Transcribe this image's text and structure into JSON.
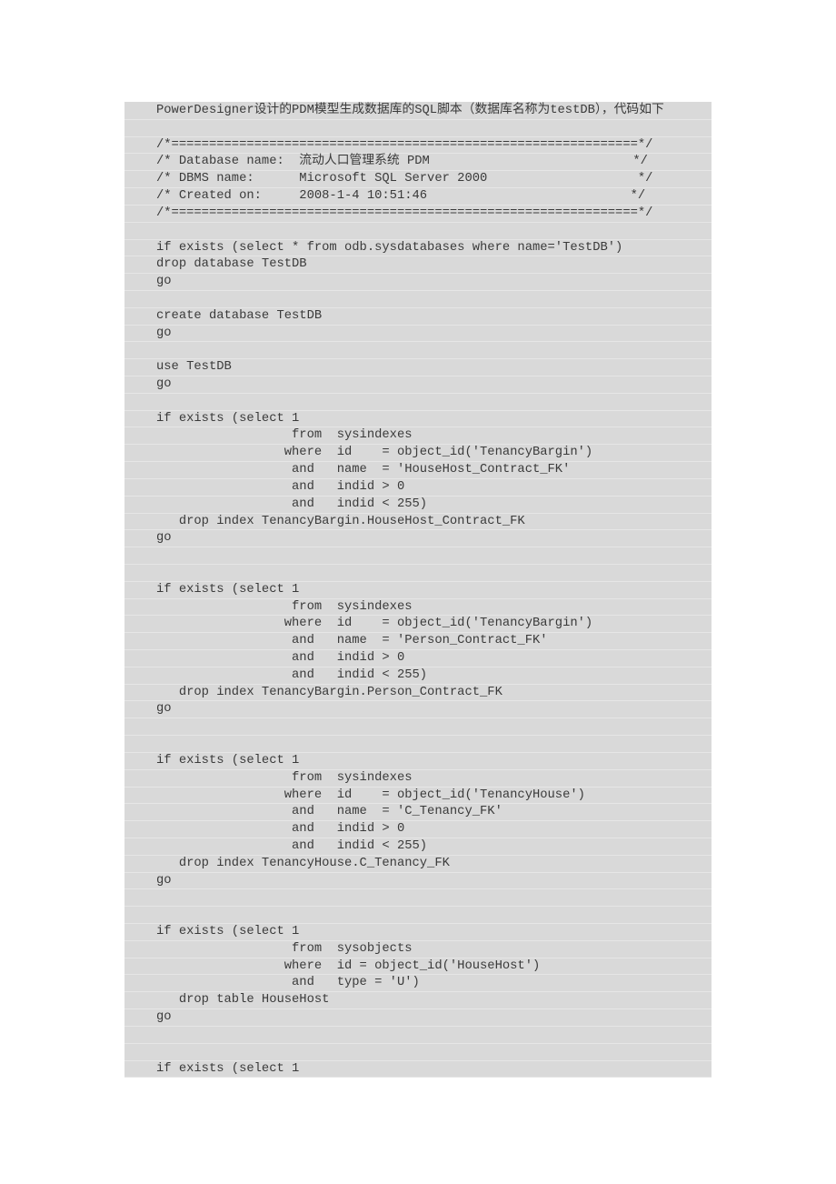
{
  "document": {
    "lines": [
      "PowerDesigner设计的PDM模型生成数据库的SQL脚本（数据库名称为testDB），代码如下",
      "",
      "/*==============================================================*/",
      "/* Database name:  流动人口管理系统 PDM                           */",
      "/* DBMS name:      Microsoft SQL Server 2000                    */",
      "/* Created on:     2008-1-4 10:51:46                           */",
      "/*==============================================================*/",
      "",
      "if exists (select * from odb.sysdatabases where name='TestDB')",
      "drop database TestDB",
      "go",
      "",
      "create database TestDB",
      "go",
      "",
      "use TestDB",
      "go",
      "",
      "if exists (select 1",
      "                  from  sysindexes",
      "                 where  id    = object_id('TenancyBargin')",
      "                  and   name  = 'HouseHost_Contract_FK'",
      "                  and   indid > 0",
      "                  and   indid < 255)",
      "   drop index TenancyBargin.HouseHost_Contract_FK",
      "go",
      "",
      "",
      "if exists (select 1",
      "                  from  sysindexes",
      "                 where  id    = object_id('TenancyBargin')",
      "                  and   name  = 'Person_Contract_FK'",
      "                  and   indid > 0",
      "                  and   indid < 255)",
      "   drop index TenancyBargin.Person_Contract_FK",
      "go",
      "",
      "",
      "if exists (select 1",
      "                  from  sysindexes",
      "                 where  id    = object_id('TenancyHouse')",
      "                  and   name  = 'C_Tenancy_FK'",
      "                  and   indid > 0",
      "                  and   indid < 255)",
      "   drop index TenancyHouse.C_Tenancy_FK",
      "go",
      "",
      "",
      "if exists (select 1",
      "                  from  sysobjects",
      "                 where  id = object_id('HouseHost')",
      "                  and   type = 'U')",
      "   drop table HouseHost",
      "go",
      "",
      "",
      "if exists (select 1"
    ]
  }
}
